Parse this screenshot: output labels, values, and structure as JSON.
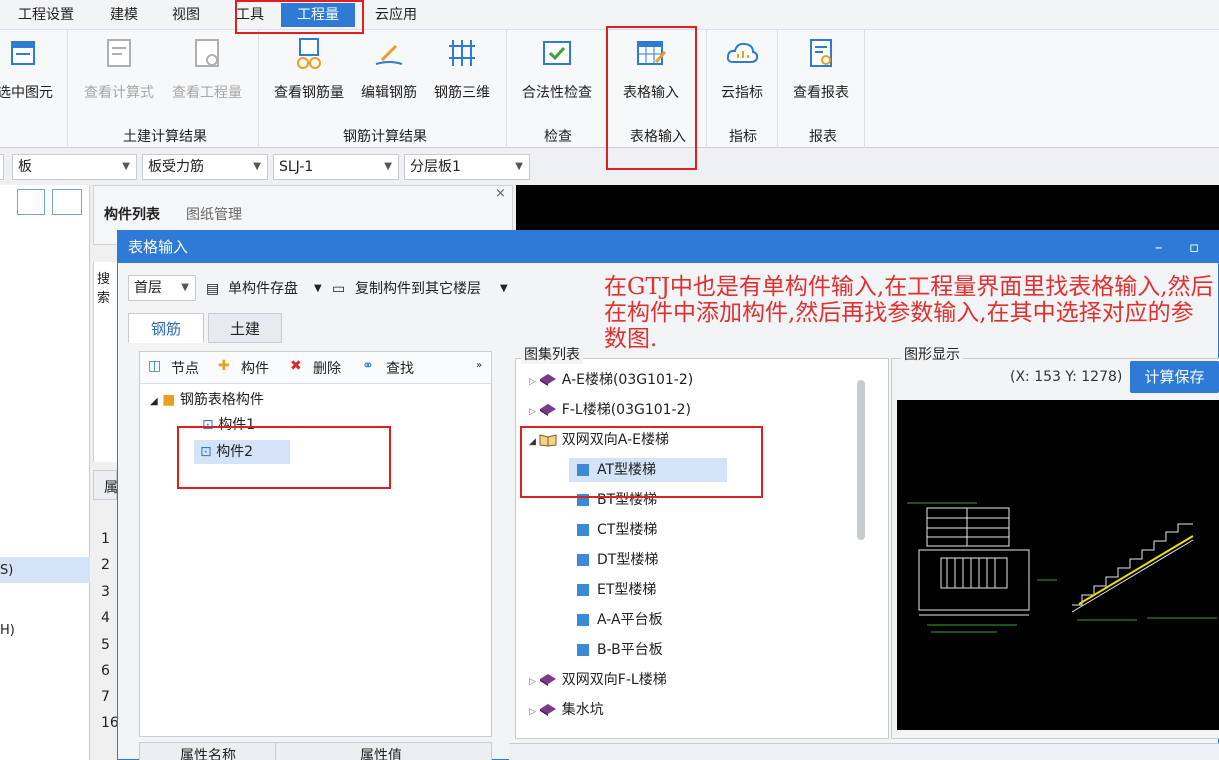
{
  "menu": [
    "工程设置",
    "建模",
    "视图",
    "工具",
    "工程量",
    "云应用"
  ],
  "ribbon": {
    "b0": "选中图元",
    "b1": "查看计算式",
    "b2": "查看工程量",
    "b3": "查看钢筋量",
    "b4": "编辑钢筋",
    "b5": "钢筋三维",
    "b6": "合法性检查",
    "b7": "表格输入",
    "b8": "云指标",
    "b9": "查看报表",
    "g1": "土建计算结果",
    "g2": "钢筋计算结果",
    "g3": "检查",
    "g4": "表格输入",
    "g5": "指标",
    "g6": "报表"
  },
  "dropdowns": [
    "板",
    "板受力筋",
    "SLJ-1",
    "分层板1"
  ],
  "leftpanel": {
    "s": "S)",
    "h": "H)"
  },
  "comppanel": {
    "tab1": "构件列表",
    "tab2": "图纸管理",
    "search": "搜索",
    "col": "属"
  },
  "rownums": [
    "1",
    "2",
    "3",
    "4",
    "5",
    "6",
    "7",
    "16"
  ],
  "dialog": {
    "title": "表格输入",
    "floor": "首层",
    "save_single": "单构件存盘",
    "copy": "复制构件到其它楼层",
    "tabs": [
      "钢筋",
      "土建"
    ],
    "toolbar": {
      "node": "节点",
      "comp": "构件",
      "del": "删除",
      "find": "查找"
    },
    "tree": {
      "root": "钢筋表格构件",
      "c1": "构件1",
      "c2": "构件2"
    },
    "atlas_title": "图集列表",
    "atlas": [
      "A-E楼梯(03G101-2)",
      "F-L楼梯(03G101-2)",
      "双网双向A-E楼梯",
      "AT型楼梯",
      "BT型楼梯",
      "CT型楼梯",
      "DT型楼梯",
      "ET型楼梯",
      "A-A平台板",
      "B-B平台板",
      "双网双向F-L楼梯",
      "集水坑"
    ],
    "graph_title": "图形显示",
    "coord": "(X: 153 Y: 1278)",
    "calc_save": "计算保存",
    "prop_name": "属性名称",
    "prop_val": "属性值"
  },
  "annotation": "在GTJ中也是有单构件输入,在工程量界面里找表格输入,然后在构件中添加构件,然后再找参数输入,在其中选择对应的参数图.",
  "colors": {
    "accent": "#2d7bd6",
    "highlight": "#e02020"
  }
}
